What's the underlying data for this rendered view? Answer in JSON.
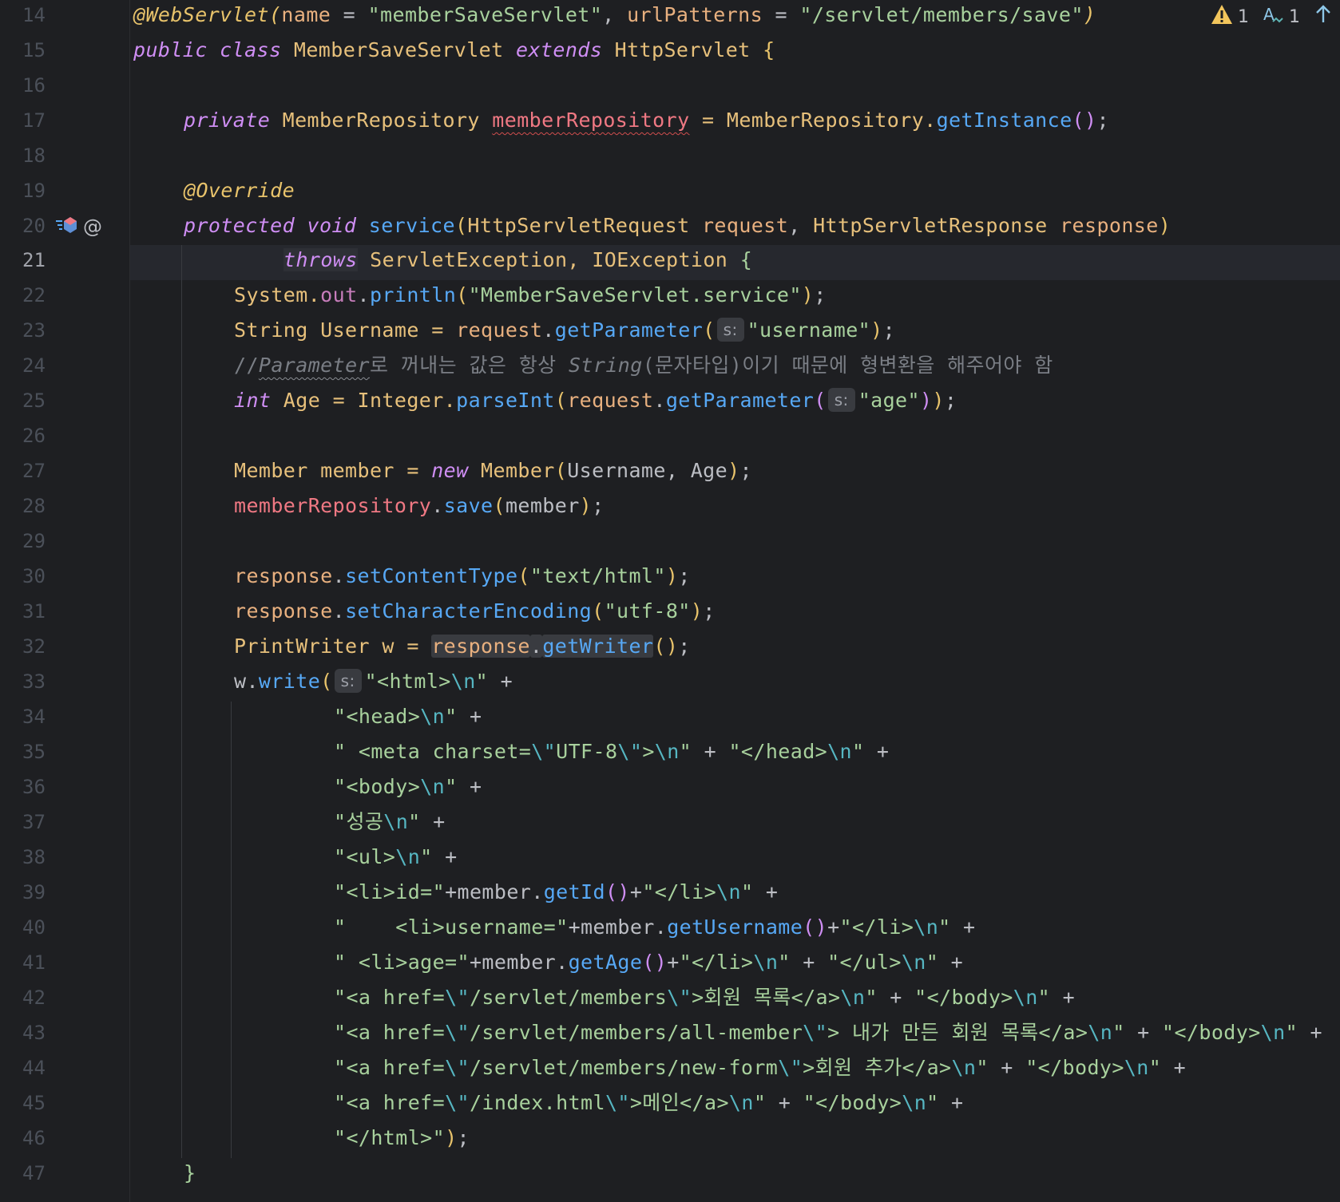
{
  "editor": {
    "language": "java",
    "current_line": 21,
    "status": {
      "warnings": "1",
      "typos": "1",
      "warning_icon": "warning-triangle-icon",
      "typo_icon": "typo-icon",
      "nav_icon": "arrow-up-icon"
    },
    "gutter_icons": {
      "line": 20,
      "override_icon": "implementing-method-icon",
      "annotation_icon": "@"
    },
    "inlay_hint": "s:",
    "colors": {
      "background": "#1e1f22",
      "keyword": "#cf8ef4",
      "string": "#a8d19d",
      "function": "#57a8f5",
      "type": "#e7c07b",
      "warning": "#f2c55c"
    }
  },
  "lines": [
    {
      "n": "14",
      "t": {
        "a": "@WebServlet(",
        "b": "name",
        "c": " = ",
        "d": "\"memberSaveServlet\"",
        "e": ", ",
        "f": "urlPatterns",
        "g": " = ",
        "h": "\"/servlet/members/save\"",
        "i": ")"
      }
    },
    {
      "n": "15",
      "t": {
        "a": "public",
        "b": " ",
        "c": "class",
        "d": " MemberSaveServlet ",
        "e": "extends",
        "f": " HttpServlet ",
        "g": "{"
      }
    },
    {
      "n": "16",
      "t": {}
    },
    {
      "n": "17",
      "t": {
        "a": "private",
        "b": " MemberRepository ",
        "c": "memberRepository",
        "d": " = MemberRepository.",
        "e": "getInstance",
        "f": "()",
        "g": ";"
      }
    },
    {
      "n": "18",
      "t": {}
    },
    {
      "n": "19",
      "t": {
        "a": "@Override"
      }
    },
    {
      "n": "20",
      "t": {
        "a": "protected",
        "b": " ",
        "c": "void",
        "d": " ",
        "e": "service",
        "f": "(",
        "g": "HttpServletRequest ",
        "h": "request",
        "i": ", ",
        "j": "HttpServletResponse ",
        "k": "response",
        "l": ")"
      }
    },
    {
      "n": "21",
      "t": {
        "a": "throws",
        "b": " ServletException, IOException ",
        "c": "{"
      }
    },
    {
      "n": "22",
      "t": {
        "a": "System.",
        "b": "out",
        "c": ".",
        "d": "println",
        "e": "(",
        "f": "\"MemberSaveServlet.service\"",
        "g": ")",
        "h": ";"
      }
    },
    {
      "n": "23",
      "t": {
        "a": "String Username = ",
        "b": "request",
        "c": ".",
        "d": "getParameter",
        "e": "(",
        "f": "\"username\"",
        "g": ")",
        "h": ";"
      }
    },
    {
      "n": "24",
      "t": {
        "a": "//",
        "b": "Parameter",
        "c": "로 꺼내는 값은 항상 ",
        "d": "String",
        "e": "(문자타입)이기 때문에 형변환을 해주어야 함"
      }
    },
    {
      "n": "25",
      "t": {
        "a": "int",
        "b": " Age = Integer.",
        "c": "parseInt",
        "d": "(",
        "e": "request",
        "f": ".",
        "g": "getParameter",
        "h": "(",
        "i": "\"age\"",
        "j": ")",
        "k": ")",
        "l": ";"
      }
    },
    {
      "n": "26",
      "t": {}
    },
    {
      "n": "27",
      "t": {
        "a": "Member member = ",
        "b": "new",
        "c": " Member",
        "d": "(",
        "e": "Username, Age",
        "f": ")",
        "g": ";"
      }
    },
    {
      "n": "28",
      "t": {
        "a": "memberRepository",
        "b": ".",
        "c": "save",
        "d": "(",
        "e": "member",
        "f": ")",
        "g": ";"
      }
    },
    {
      "n": "29",
      "t": {}
    },
    {
      "n": "30",
      "t": {
        "a": "response",
        "b": ".",
        "c": "setContentType",
        "d": "(",
        "e": "\"text/html\"",
        "f": ")",
        "g": ";"
      }
    },
    {
      "n": "31",
      "t": {
        "a": "response",
        "b": ".",
        "c": "setCharacterEncoding",
        "d": "(",
        "e": "\"utf-8\"",
        "f": ")",
        "g": ";"
      }
    },
    {
      "n": "32",
      "t": {
        "a": "PrintWriter w = ",
        "b": "response",
        "c": ".",
        "d": "getWriter",
        "e": "()",
        "f": ";"
      }
    },
    {
      "n": "33",
      "t": {
        "a": "w.",
        "b": "write",
        "c": "(",
        "d": "\"<html>",
        "e": "\\n",
        "f": "\"",
        "g": " +"
      }
    },
    {
      "n": "34",
      "t": {
        "a": "\"<head>",
        "b": "\\n",
        "c": "\"",
        "d": " +"
      }
    },
    {
      "n": "35",
      "t": {
        "a": "\" <meta charset=",
        "b": "\\\"",
        "c": "UTF-8",
        "d": "\\\"",
        "e": ">",
        "f": "\\n",
        "g": "\"",
        "h": " + ",
        "i": "\"</head>",
        "j": "\\n",
        "k": "\"",
        "l": " +"
      }
    },
    {
      "n": "36",
      "t": {
        "a": "\"<body>",
        "b": "\\n",
        "c": "\"",
        "d": " +"
      }
    },
    {
      "n": "37",
      "t": {
        "a": "\"성공",
        "b": "\\n",
        "c": "\"",
        "d": " +"
      }
    },
    {
      "n": "38",
      "t": {
        "a": "\"<ul>",
        "b": "\\n",
        "c": "\"",
        "d": " +"
      }
    },
    {
      "n": "39",
      "t": {
        "a": "\"<li>id=\"",
        "b": "+member.",
        "c": "getId",
        "d": "()",
        "e": "+",
        "f": "\"</li>",
        "g": "\\n",
        "h": "\"",
        "i": " +"
      }
    },
    {
      "n": "40",
      "t": {
        "a": "\"    <li>username=\"",
        "b": "+member.",
        "c": "getUsername",
        "d": "()",
        "e": "+",
        "f": "\"</li>",
        "g": "\\n",
        "h": "\"",
        "i": " +"
      }
    },
    {
      "n": "41",
      "t": {
        "a": "\" <li>age=\"",
        "b": "+member.",
        "c": "getAge",
        "d": "()",
        "e": "+",
        "f": "\"</li>",
        "g": "\\n",
        "h": "\"",
        "i": " + ",
        "j": "\"</ul>",
        "k": "\\n",
        "l": "\"",
        "m": " +"
      }
    },
    {
      "n": "42",
      "t": {
        "a": "\"<a href=",
        "b": "\\\"",
        "c": "/servlet/members",
        "d": "\\\"",
        "e": ">회원 목록</a>",
        "f": "\\n",
        "g": "\"",
        "h": " + ",
        "i": "\"</body>",
        "j": "\\n",
        "k": "\"",
        "l": " +"
      }
    },
    {
      "n": "43",
      "t": {
        "a": "\"<a href=",
        "b": "\\\"",
        "c": "/servlet/members/all-member",
        "d": "\\\"",
        "e": "> 내가 만든 회원 목록</a>",
        "f": "\\n",
        "g": "\"",
        "h": " + ",
        "i": "\"</body>",
        "j": "\\n",
        "k": "\"",
        "l": " +"
      }
    },
    {
      "n": "44",
      "t": {
        "a": "\"<a href=",
        "b": "\\\"",
        "c": "/servlet/members/new-form",
        "d": "\\\"",
        "e": ">회원 추가</a>",
        "f": "\\n",
        "g": "\"",
        "h": " + ",
        "i": "\"</body>",
        "j": "\\n",
        "k": "\"",
        "l": " +"
      }
    },
    {
      "n": "45",
      "t": {
        "a": "\"<a href=",
        "b": "\\\"",
        "c": "/index.html",
        "d": "\\\"",
        "e": ">메인</a>",
        "f": "\\n",
        "g": "\"",
        "h": " + ",
        "i": "\"</body>",
        "j": "\\n",
        "k": "\"",
        "l": " +"
      }
    },
    {
      "n": "46",
      "t": {
        "a": "\"</html>\"",
        "b": ")",
        "c": ";"
      }
    },
    {
      "n": "47",
      "t": {
        "a": "}"
      }
    }
  ]
}
